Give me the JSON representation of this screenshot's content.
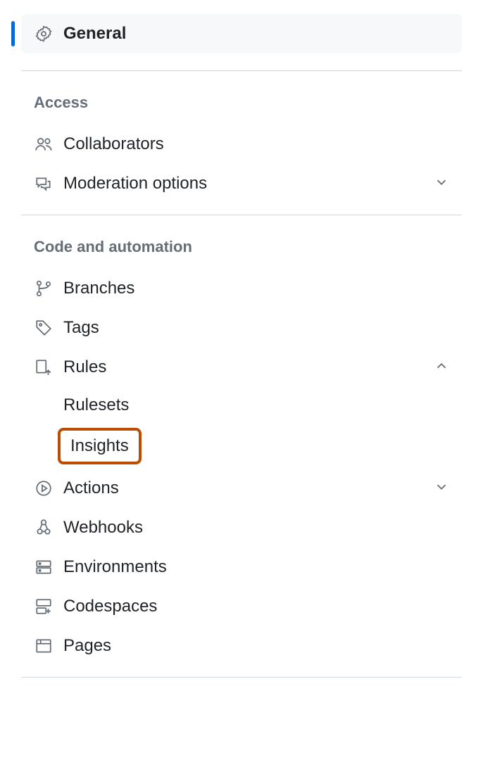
{
  "selected": {
    "label": "General"
  },
  "sections": {
    "access": {
      "header": "Access",
      "collaborators": "Collaborators",
      "moderation": "Moderation options"
    },
    "code": {
      "header": "Code and automation",
      "branches": "Branches",
      "tags": "Tags",
      "rules": "Rules",
      "rulesets": "Rulesets",
      "insights": "Insights",
      "actions": "Actions",
      "webhooks": "Webhooks",
      "environments": "Environments",
      "codespaces": "Codespaces",
      "pages": "Pages"
    }
  }
}
